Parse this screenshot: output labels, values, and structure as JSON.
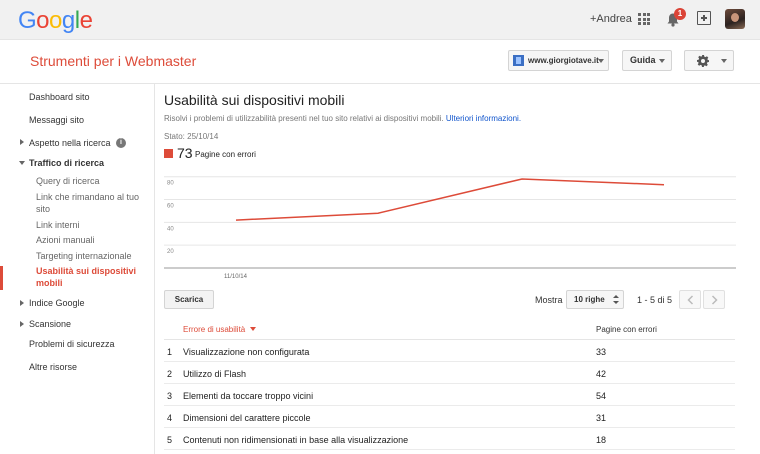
{
  "topbar": {
    "logo_letters": [
      {
        "ch": "G",
        "color": "#4285f4"
      },
      {
        "ch": "o",
        "color": "#ea4335"
      },
      {
        "ch": "o",
        "color": "#fbbc05"
      },
      {
        "ch": "g",
        "color": "#4285f4"
      },
      {
        "ch": "l",
        "color": "#34a853"
      },
      {
        "ch": "e",
        "color": "#ea4335"
      }
    ],
    "user_link": "+Andrea",
    "notification_count": "1",
    "icons": [
      "apps-icon",
      "bell-icon",
      "share-icon",
      "avatar"
    ]
  },
  "header": {
    "product_title": "Strumenti per i Webmaster",
    "site": "www.giorgiotave.it",
    "guide_label": "Guida",
    "accent_color": "#dd4b39"
  },
  "sidebar": {
    "items": [
      {
        "label": "Dashboard sito"
      },
      {
        "label": "Messaggi sito"
      },
      {
        "label": "Aspetto nella ricerca"
      },
      {
        "label": "Traffico di ricerca"
      },
      {
        "label": "Query di ricerca"
      },
      {
        "label": "Link che rimandano al tuo"
      },
      {
        "label": "sito"
      },
      {
        "label": "Link interni"
      },
      {
        "label": "Azioni manuali"
      },
      {
        "label": "Targeting internazionale"
      },
      {
        "label": "Usabilità sui dispositivi"
      },
      {
        "label": "mobili"
      },
      {
        "label": "Indice Google"
      },
      {
        "label": "Scansione"
      },
      {
        "label": "Problemi di sicurezza"
      },
      {
        "label": "Altre risorse"
      }
    ],
    "info_glyph": "i"
  },
  "main": {
    "title": "Usabilità sui dispositivi mobili",
    "description": "Risolvi i problemi di utilizzabilità presenti nel tuo sito relativi ai dispositivi mobili.",
    "more_info_link": "Ulteriori informazioni.",
    "status": "Stato: 25/10/14",
    "metric_value": "73",
    "metric_label": "Pagine con errori",
    "download_button": "Scarica",
    "show_label": "Mostra",
    "rows_select": "10 righe",
    "pager_text": "1 - 5 di 5"
  },
  "chart_data": {
    "type": "line",
    "x": [
      "11/10/14",
      "",
      "",
      "",
      ""
    ],
    "x_tick_labels": [
      "11/10/14"
    ],
    "series": [
      {
        "values": [
          42,
          48,
          78,
          73
        ],
        "color": "#dd4b39"
      }
    ],
    "y_ticks": [
      "80",
      "60",
      "40",
      "20"
    ],
    "ylim": [
      0,
      85
    ],
    "grid": true
  },
  "table": {
    "headers": {
      "issue": "Errore di usabilità",
      "pages": "Pagine con errori"
    },
    "rows": [
      {
        "idx": "1",
        "issue": "Visualizzazione non configurata",
        "count": "33"
      },
      {
        "idx": "2",
        "issue": "Utilizzo di Flash",
        "count": "42"
      },
      {
        "idx": "3",
        "issue": "Elementi da toccare troppo vicini",
        "count": "54"
      },
      {
        "idx": "4",
        "issue": "Dimensioni del carattere piccole",
        "count": "31"
      },
      {
        "idx": "5",
        "issue": "Contenuti non ridimensionati in base alla visualizzazione",
        "count": "18"
      }
    ]
  }
}
